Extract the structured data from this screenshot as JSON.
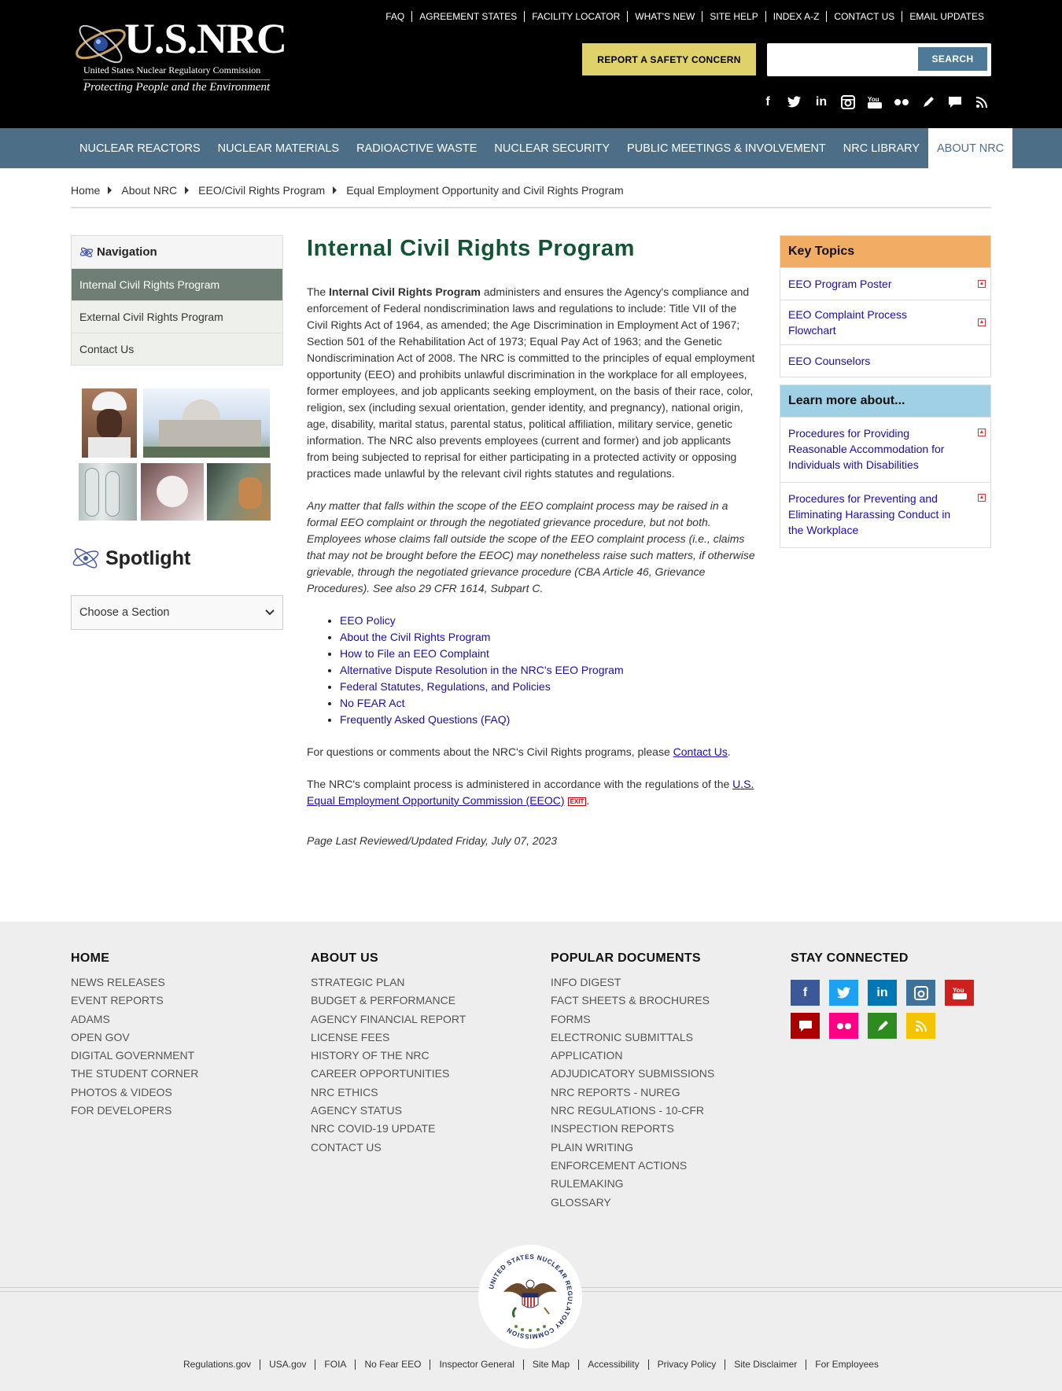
{
  "header": {
    "logo_title": "U.S.NRC",
    "logo_subtitle": "United States Nuclear Regulatory Commission",
    "logo_tagline": "Protecting People and the Environment",
    "util_links": [
      "FAQ",
      "AGREEMENT STATES",
      "FACILITY LOCATOR",
      "WHAT'S NEW",
      "SITE HELP",
      "INDEX A-Z",
      "CONTACT US",
      "EMAIL UPDATES"
    ],
    "report_label": "REPORT A SAFETY CONCERN",
    "search_label": "SEARCH",
    "search_value": ""
  },
  "social_icons": [
    "facebook-icon",
    "twitter-icon",
    "linkedin-icon",
    "instagram-icon",
    "youtube-icon",
    "flickr-icon",
    "blog-icon",
    "comment-icon",
    "rss-icon"
  ],
  "nav": {
    "items": [
      "NUCLEAR REACTORS",
      "NUCLEAR MATERIALS",
      "RADIOACTIVE WASTE",
      "NUCLEAR SECURITY",
      "PUBLIC MEETINGS & INVOLVEMENT",
      "NRC LIBRARY",
      "ABOUT NRC"
    ],
    "active": "ABOUT NRC"
  },
  "breadcrumb": [
    "Home",
    "About NRC",
    "EEO/Civil Rights Program",
    "Equal Employment Opportunity and Civil Rights Program"
  ],
  "left_nav": {
    "title": "Navigation",
    "items": [
      "Internal Civil Rights Program",
      "External Civil Rights Program",
      "Contact Us"
    ]
  },
  "spotlight": {
    "title": "Spotlight",
    "select_value": "Choose a Section"
  },
  "main": {
    "title": "Internal Civil Rights Program",
    "p1_lead": "The ",
    "p1_bold": "Internal Civil Rights Program",
    "p1_rest": " administers and ensures the Agency's compliance and enforcement of Federal nondiscrimination laws and regulations to include: Title VII of the Civil Rights Act of 1964, as amended; the Age Discrimination in Employment Act of 1967; Section 501 of the Rehabilitation Act of 1973; Equal Pay Act of 1963; and the Genetic Nondiscrimination Act of 2008. The NRC is committed to the principles of equal employment opportunity (EEO) and prohibits unlawful discrimination in the workplace for all employees, former employees, and job applicants seeking employment, on the basis of their race, color, religion, sex (including sexual orientation, gender identity, and pregnancy), national origin, age, disability, marital status, parental status, political affiliation, military service, genetic information.  The NRC also prevents employees (current and former) and job applicants from being subjected to reprisal for either participating in a protected activity or opposing practices made unlawful by the relevant civil rights statutes and regulations.",
    "p2": "Any matter that falls within the scope of the EEO complaint process may be raised in a formal EEO complaint or through the negotiated grievance procedure, but not both. Employees whose claims fall outside the scope of the EEO complaint process (i.e., claims that may not be brought before the EEOC) may nonetheless raise such matters, if otherwise grievable, through the negotiated grievance procedure (CBA Article 46, Grievance Procedures). See also 29 CFR 1614, Subpart C.",
    "links": [
      "EEO Policy",
      "About the Civil Rights Program",
      "How to File an EEO Complaint",
      "Alternative Dispute Resolution in the NRC's EEO Program",
      "Federal Statutes, Regulations, and Policies",
      "No FEAR Act",
      "Frequently Asked Questions (FAQ)"
    ],
    "p3_lead": "For questions or comments about the NRC's Civil Rights programs, please ",
    "p3_link": "Contact Us",
    "p3_end": ".",
    "p4_lead": "The NRC's complaint process is administered in accordance with the regulations of the ",
    "p4_link": "U.S. Equal Employment Opportunity Commission (EEOC)",
    "p4_exit": "EXIT",
    "p4_end": ".",
    "updated": "Page Last Reviewed/Updated Friday, July 07, 2023"
  },
  "key_topics": {
    "title": "Key Topics",
    "items": [
      "EEO Program Poster",
      "EEO Complaint Process Flowchart",
      "EEO Counselors"
    ],
    "has_pdf": [
      true,
      true,
      false
    ]
  },
  "learn_more": {
    "title": "Learn more about...",
    "items": [
      "Procedures for Providing Reasonable Accommodation for Individuals with Disabilities",
      "Procedures for Preventing and Eliminating Harassing Conduct in the Workplace"
    ]
  },
  "footer": {
    "home": {
      "title": "HOME",
      "links": [
        "NEWS RELEASES",
        "EVENT REPORTS",
        "ADAMS",
        "OPEN GOV",
        "DIGITAL GOVERNMENT",
        "THE STUDENT CORNER",
        "PHOTOS & VIDEOS",
        "FOR DEVELOPERS"
      ]
    },
    "about": {
      "title": "ABOUT US",
      "links": [
        "STRATEGIC PLAN",
        "BUDGET & PERFORMANCE",
        "AGENCY FINANCIAL REPORT",
        "LICENSE FEES",
        "HISTORY OF THE NRC",
        "CAREER OPPORTUNITIES",
        "NRC ETHICS",
        "AGENCY STATUS",
        "NRC COVID-19 UPDATE",
        "CONTACT US"
      ]
    },
    "popular": {
      "title": "POPULAR DOCUMENTS",
      "links": [
        "INFO DIGEST",
        "FACT SHEETS & BROCHURES",
        "FORMS",
        "ELECTRONIC SUBMITTALS APPLICATION",
        "ADJUDICATORY SUBMISSIONS",
        "NRC REPORTS - NUREG",
        "NRC REGULATIONS - 10-CFR",
        "INSPECTION REPORTS",
        "PLAIN WRITING",
        "ENFORCEMENT ACTIONS",
        "RULEMAKING",
        "GLOSSARY"
      ]
    },
    "connect": {
      "title": "STAY CONNECTED"
    },
    "seal_text": "UNITED STATES NUCLEAR REGULATORY COMMISSION",
    "bottom_links": [
      "Regulations.gov",
      "USA.gov",
      "FOIA",
      "No Fear EEO",
      "Inspector General",
      "Site Map",
      "Accessibility",
      "Privacy Policy",
      "Site Disclaimer",
      "For Employees"
    ]
  },
  "colors": {
    "nav_bg": "#4c6e87",
    "title_green": "#125535",
    "report_yellow": "#dfd26a",
    "key_topics_bg": "#f0ad63",
    "learn_more_bg": "#9fd0e6",
    "active_nav_item": "#6f7f76"
  }
}
